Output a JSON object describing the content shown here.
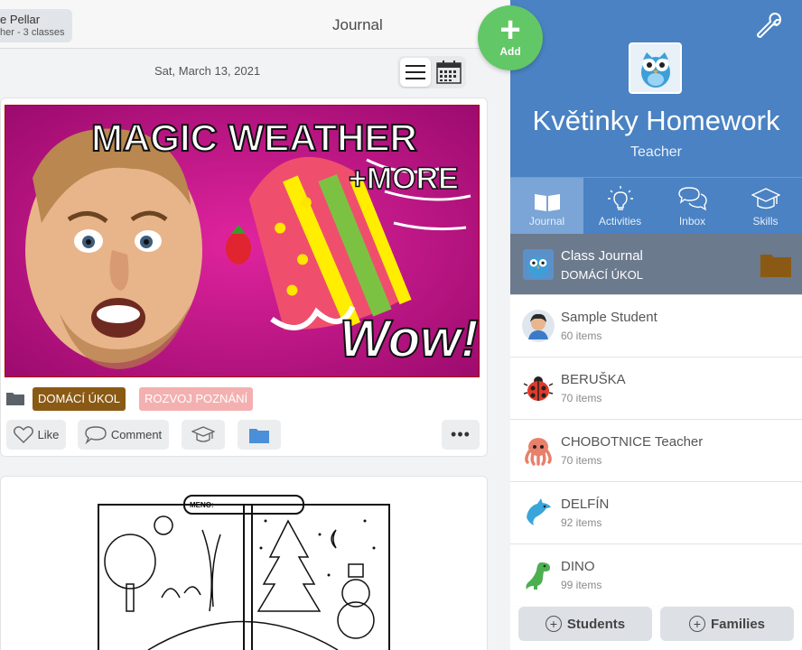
{
  "user": {
    "name": "e Pellar",
    "role": "her - 3 classes"
  },
  "nav": {
    "title": "Journal"
  },
  "date": "Sat, March 13, 2021",
  "post": {
    "image_text": {
      "line1": "MAGIC WEATHER",
      "line2": "+MORE",
      "wow": "Wow!"
    },
    "tags": [
      "DOMÁCÍ ÚKOL",
      "ROZVOJ POZNÁNÍ"
    ],
    "tag_colors": [
      "#8a5a14",
      "#f4b0b0"
    ],
    "actions": {
      "like": "Like",
      "comment": "Comment",
      "more": "•••"
    }
  },
  "worksheet": {
    "name_label": "MENO:"
  },
  "add_button": {
    "label": "Add",
    "color": "#62c766"
  },
  "class": {
    "name": "Květinky Homework",
    "role": "Teacher",
    "header_color": "#4a82c3"
  },
  "tabs": [
    {
      "label": "Journal",
      "icon": "book-icon"
    },
    {
      "label": "Activities",
      "icon": "lightbulb-icon"
    },
    {
      "label": "Inbox",
      "icon": "chat-icon"
    },
    {
      "label": "Skills",
      "icon": "graduation-cap-icon"
    }
  ],
  "class_journal": {
    "title": "Class Journal",
    "subtitle": "DOMÁCÍ ÚKOL"
  },
  "students": [
    {
      "name": "Sample Student",
      "count": "60 items",
      "icon": "student-avatar-icon"
    },
    {
      "name": "BERUŠKA",
      "count": "70 items",
      "icon": "ladybug-icon"
    },
    {
      "name": "CHOBOTNICE Teacher",
      "count": "70 items",
      "icon": "octopus-icon"
    },
    {
      "name": "DELFÍN",
      "count": "92 items",
      "icon": "dolphin-icon"
    },
    {
      "name": "DINO",
      "count": "99 items",
      "icon": "dinosaur-icon"
    }
  ],
  "bottom": {
    "students": "Students",
    "families": "Families"
  }
}
